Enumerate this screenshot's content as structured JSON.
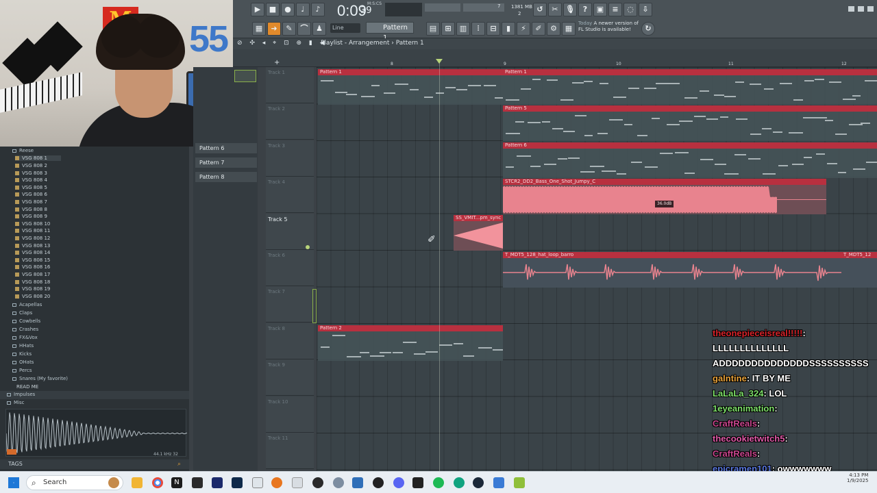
{
  "stream": {
    "webcam_number": "55",
    "logo_letter": "M"
  },
  "toolbar": {
    "time": "0:09",
    "time_frac": "39",
    "time_label": "M:S:CS",
    "memory": "1381 MB",
    "cpu_value": "7",
    "voices": "2",
    "line_mode": "Line",
    "pattern_selector": "Pattern 1",
    "news_title": "Today",
    "news_text": "A newer version of FL Studio is available!"
  },
  "playlist": {
    "title": "Playlist - Arrangement",
    "breadcrumb_arrow": "›",
    "current_pattern": "Pattern 1",
    "ruler": [
      "8",
      "9",
      "10",
      "11",
      "12"
    ],
    "tracks": [
      "Track 1",
      "Track 2",
      "Track 3",
      "Track 4",
      "Track 5",
      "Track 6",
      "Track 7",
      "Track 8",
      "Track 9",
      "Track 10",
      "Track 11"
    ],
    "clips": {
      "pattern1_a": "Pattern 1",
      "pattern1_b": "Pattern 1",
      "pattern5": "Pattern 5",
      "pattern6": "Pattern 6",
      "bass": "STCR2_DD2_Bass_One_Shot_Jumpy_C",
      "vmit": "SS_VMIT...pm_sync",
      "hat_a": "T_MDT5_128_hat_loop_barro",
      "hat_b": "T_MDT5_12",
      "pattern2": "Pattern 2"
    },
    "db_tag": "36.0dB"
  },
  "patterns_panel": [
    "Pattern 6",
    "Pattern 7",
    "Pattern 8"
  ],
  "browser": {
    "top_folder": "Reese",
    "selected": "VSG 808 1",
    "items": [
      "VSG 808 2",
      "VSG 808 3",
      "VSG 808 4",
      "VSG 808 5",
      "VSG 808 6",
      "VSG 808 7",
      "VSG 808 8",
      "VSG 808 9",
      "VSG 808 10",
      "VSG 808 11",
      "VSG 808 12",
      "VSG 808 13",
      "VSG 808 14",
      "VSG 808 15",
      "VSG 808 16",
      "VSG 808 17",
      "VSG 808 18",
      "VSG 808 19",
      "VSG 808 20"
    ],
    "folders": [
      "Acapellas",
      "Claps",
      "Cowbells",
      "Crashes",
      "FX&Vox",
      "HHats",
      "Kicks",
      "OHats",
      "Percs",
      "Snares (My favorite)"
    ],
    "readme": "READ ME",
    "impulses": "Impulses",
    "misc": "Misc",
    "sample_rate": "44.1 kHz 32",
    "tags": "TAGS"
  },
  "chat": [
    {
      "user": "theonepieceisreal!!!!!",
      "text": ":",
      "color": "#d8232a"
    },
    {
      "user": "",
      "text": "LLLLLLLLLLLLLL",
      "color": "#ffffff"
    },
    {
      "user": "",
      "text": "ADDDDDDDDDDDDDDSSSSSSSSSS",
      "color": "#ffffff"
    },
    {
      "user": "galntine",
      "text": ": IT BY ME",
      "color": "#e8a23a"
    },
    {
      "user": "LaLaLa_324",
      "text": ": LOL",
      "color": "#7ee06a"
    },
    {
      "user": "1eyeanimation",
      "text": ":",
      "color": "#7ee06a"
    },
    {
      "user": "CraftReals",
      "text": ":",
      "color": "#c9468e"
    },
    {
      "user": "thecookietwitch5",
      "text": ":",
      "color": "#e05aa8"
    },
    {
      "user": "CraftReals",
      "text": ":",
      "color": "#c9468e"
    },
    {
      "user": "epicramen101",
      "text": ": owwwwwww",
      "color": "#5a78e0"
    }
  ],
  "taskbar": {
    "search_placeholder": "Search",
    "time": "4:13 PM",
    "date": "1/9/2025"
  },
  "colors": {
    "clip_red": "#b8303f",
    "grid_bg": "#3a4348",
    "audio_pink": "#f2939c"
  }
}
